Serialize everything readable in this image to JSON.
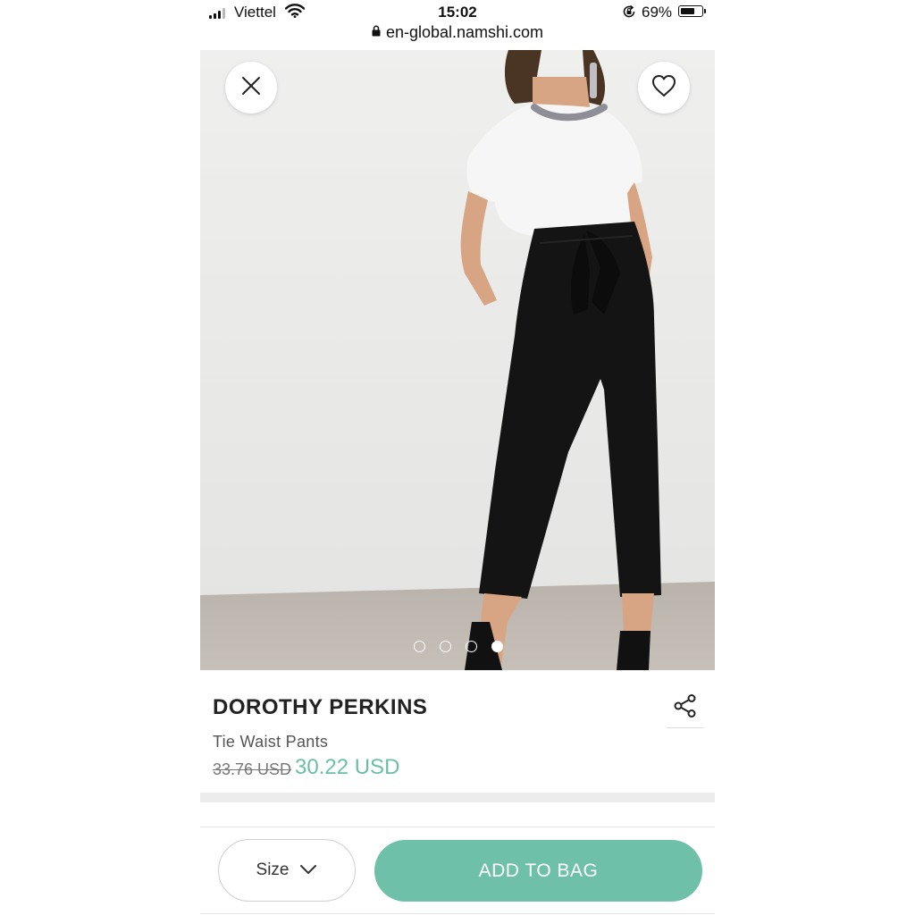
{
  "status_bar": {
    "carrier": "Viettel",
    "time": "15:02",
    "battery": "69%",
    "battery_level": 0.69
  },
  "browser": {
    "url": "en-global.namshi.com"
  },
  "gallery": {
    "image_count": 4,
    "active_index": 3,
    "close_icon": "close-icon",
    "wishlist_icon": "heart-outline-icon"
  },
  "product": {
    "brand": "DOROTHY PERKINS",
    "name": "Tie Waist Pants",
    "old_price": "33.76 USD",
    "new_price": "30.22 USD"
  },
  "actions": {
    "size_label": "Size",
    "add_to_bag_label": "ADD TO BAG",
    "share_icon": "share-icon"
  },
  "colors": {
    "accent": "#6ec0a9",
    "price": "#6bbfa8",
    "strike_price": "#777777"
  }
}
